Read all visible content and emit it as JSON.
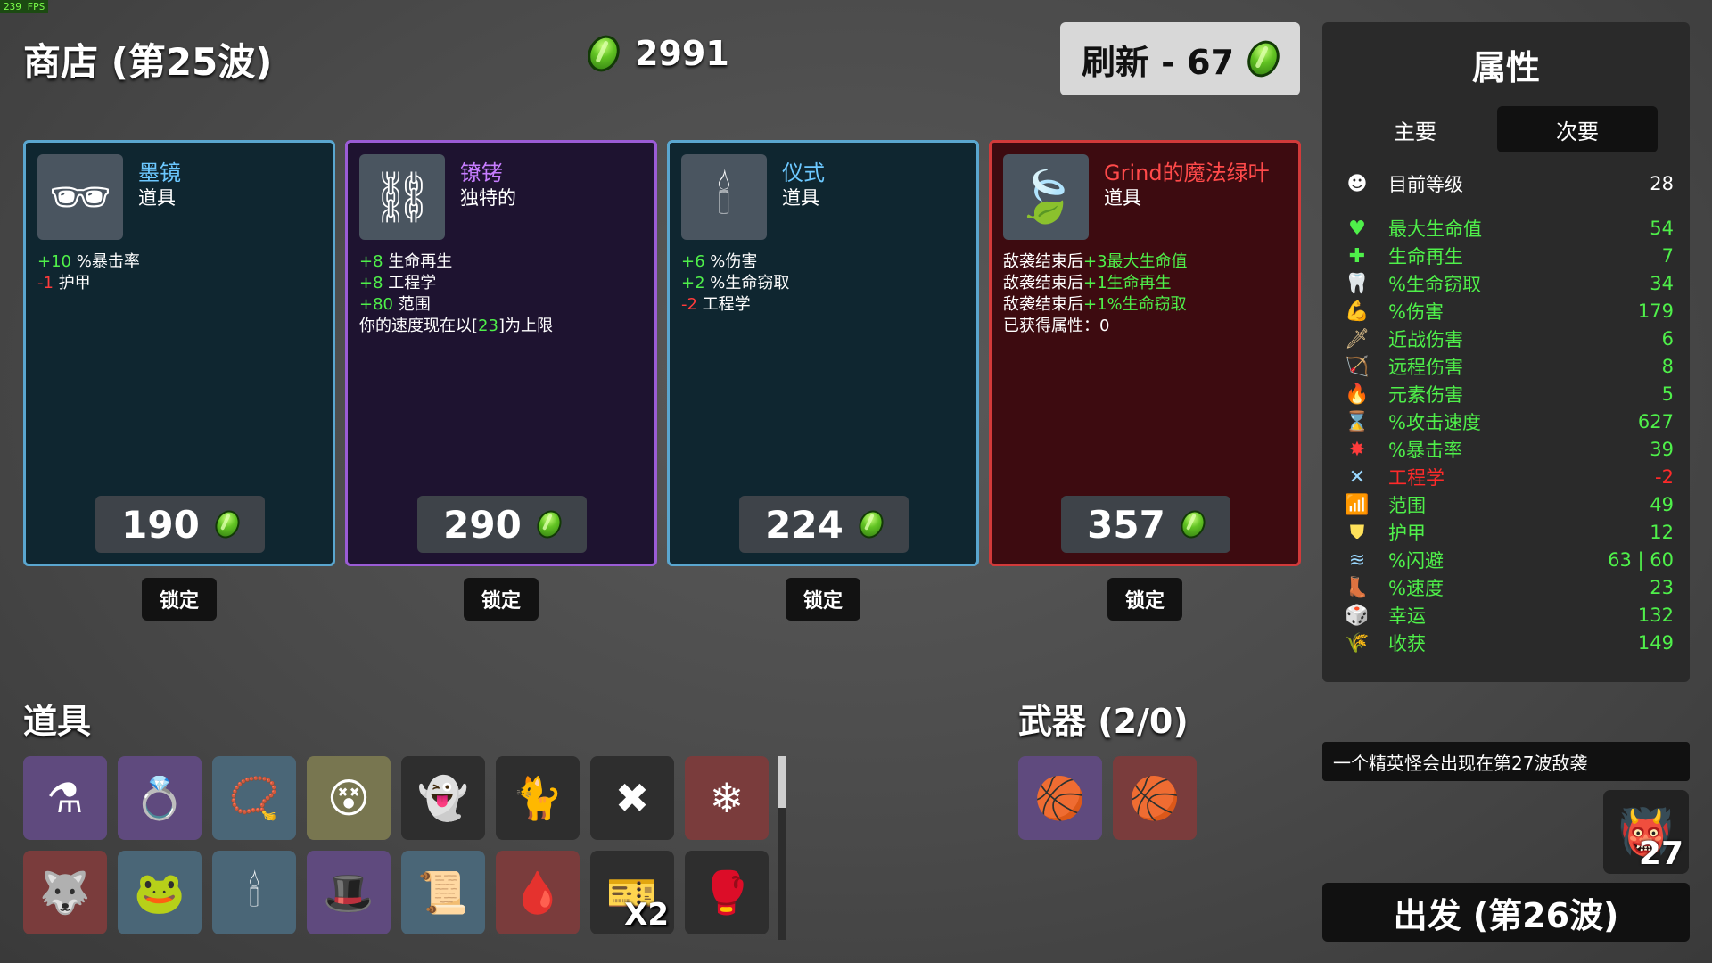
{
  "fps": "239 FPS",
  "header": {
    "title": "商店 (第25波)",
    "gold": "2991",
    "reroll_label": "刷新 - 67"
  },
  "shop": [
    {
      "name": "墨镜",
      "type": "道具",
      "name_color": "#6cc8ff",
      "border": "#5aa6cf",
      "bg": "#0f2630",
      "icon": "sunglasses-icon",
      "stats": [
        [
          "+10",
          " %暴击率"
        ],
        [
          "-1",
          " 护甲"
        ]
      ],
      "price": "190",
      "lock": "锁定"
    },
    {
      "name": "镣铐",
      "type": "独特的",
      "name_color": "#c77dff",
      "border": "#9b5cd6",
      "bg": "#1e1330",
      "icon": "shackles-icon",
      "stats": [
        [
          "+8",
          " 生命再生"
        ],
        [
          "+8",
          " 工程学"
        ],
        [
          "+80",
          " 范围"
        ]
      ],
      "extra": [
        "你的速度现在以[",
        "23",
        "]为上限"
      ],
      "price": "290",
      "lock": "锁定"
    },
    {
      "name": "仪式",
      "type": "道具",
      "name_color": "#6cc8ff",
      "border": "#5aa6cf",
      "bg": "#0f2630",
      "icon": "ritual-icon",
      "stats": [
        [
          "+6",
          " %伤害"
        ],
        [
          "+2",
          " %生命窃取"
        ],
        [
          "-2",
          " 工程学"
        ]
      ],
      "price": "224",
      "lock": "锁定"
    },
    {
      "name": "Grind的魔法绿叶",
      "type": "道具",
      "name_color": "#ff4a4a",
      "border": "#d23a3a",
      "bg": "#3d0b10",
      "icon": "magic-leaf-icon",
      "lines": [
        [
          "敌袭结束后",
          "+3最大生命值"
        ],
        [
          "敌袭结束后",
          "+1生命再生"
        ],
        [
          "敌袭结束后",
          "+1%生命窃取"
        ]
      ],
      "acquired": "已获得属性：0",
      "price": "357",
      "lock": "锁定"
    }
  ],
  "items_title": "道具",
  "items": [
    {
      "icon": "potion-machine-icon",
      "glyph": "⚗",
      "cls": "c-purple"
    },
    {
      "icon": "ring-icon",
      "glyph": "💍",
      "cls": "c-purple"
    },
    {
      "icon": "pendant-icon",
      "glyph": "📿",
      "cls": "c-blue"
    },
    {
      "icon": "face-icon",
      "glyph": "😵",
      "cls": "c-gold"
    },
    {
      "icon": "ghost-icon",
      "glyph": "👻",
      "cls": "c-dark"
    },
    {
      "icon": "cat-icon",
      "glyph": "🐈",
      "cls": "c-dark"
    },
    {
      "icon": "red-cross-icon",
      "glyph": "✖",
      "cls": "c-dark"
    },
    {
      "icon": "snowflake-icon",
      "glyph": "❄",
      "cls": "c-red"
    },
    {
      "icon": "wolf-icon",
      "glyph": "🐺",
      "cls": "c-red"
    },
    {
      "icon": "frog-icon",
      "glyph": "🐸",
      "cls": "c-blue"
    },
    {
      "icon": "ritual-item-icon",
      "glyph": "🕯",
      "cls": "c-blue"
    },
    {
      "icon": "hat-icon",
      "glyph": "🎩",
      "cls": "c-purple"
    },
    {
      "icon": "scroll-icon",
      "glyph": "📜",
      "cls": "c-blue"
    },
    {
      "icon": "claw-icon",
      "glyph": "🩸",
      "cls": "c-red"
    },
    {
      "icon": "ticket-icon",
      "glyph": "🎫",
      "cls": "c-dark",
      "count": "X2"
    },
    {
      "icon": "boxing-glove-icon",
      "glyph": "🥊",
      "cls": "c-dark"
    }
  ],
  "weapons_title": "武器 (2/0)",
  "weapons": [
    {
      "icon": "ball-icon",
      "glyph": "🏀",
      "cls": "c-purple"
    },
    {
      "icon": "ball-icon",
      "glyph": "🏀",
      "cls": "c-red"
    }
  ],
  "stats_panel": {
    "title": "属性",
    "tab_primary": "主要",
    "tab_secondary": "次要",
    "level_label": "目前等级",
    "level_value": "28",
    "rows": [
      {
        "icon": "heart-icon",
        "glyph": "♥",
        "icolor": "#4ff04a",
        "label": "最大生命值",
        "value": "54",
        "color": "#4ff04a"
      },
      {
        "icon": "heart-plus-icon",
        "glyph": "✚",
        "icolor": "#4ff04a",
        "label": "生命再生",
        "value": "7",
        "color": "#4ff04a"
      },
      {
        "icon": "fangs-icon",
        "glyph": "🦷",
        "icolor": "#ff6060",
        "label": "%生命窃取",
        "value": "34",
        "color": "#4ff04a"
      },
      {
        "icon": "muscle-icon",
        "glyph": "💪",
        "icolor": "#ff8080",
        "label": "%伤害",
        "value": "179",
        "color": "#4ff04a"
      },
      {
        "icon": "sword-icon",
        "glyph": "🗡",
        "icolor": "#e8c890",
        "label": "近战伤害",
        "value": "6",
        "color": "#4ff04a"
      },
      {
        "icon": "bow-icon",
        "glyph": "🏹",
        "icolor": "#d080ff",
        "label": "远程伤害",
        "value": "8",
        "color": "#4ff04a"
      },
      {
        "icon": "flame-icon",
        "glyph": "🔥",
        "icolor": "#ff9a4a",
        "label": "元素伤害",
        "value": "5",
        "color": "#4ff04a"
      },
      {
        "icon": "hourglass-icon",
        "glyph": "⌛",
        "icolor": "#ffffff",
        "label": "%攻击速度",
        "value": "627",
        "color": "#4ff04a"
      },
      {
        "icon": "crit-icon",
        "glyph": "✸",
        "icolor": "#ff3b3b",
        "label": "%暴击率",
        "value": "39",
        "color": "#4ff04a"
      },
      {
        "icon": "wrench-icon",
        "glyph": "✕",
        "icolor": "#9ad8ff",
        "label": "工程学",
        "value": "-2",
        "color": "#ff2a2a"
      },
      {
        "icon": "range-icon",
        "glyph": "📶",
        "icolor": "#d080ff",
        "label": "范围",
        "value": "49",
        "color": "#4ff04a"
      },
      {
        "icon": "shield-icon",
        "glyph": "⛊",
        "icolor": "#ffe15a",
        "label": "护甲",
        "value": "12",
        "color": "#4ff04a"
      },
      {
        "icon": "dodge-icon",
        "glyph": "≋",
        "icolor": "#9ad8ff",
        "label": "%闪避",
        "value": "63 | 60",
        "color": "#4ff04a"
      },
      {
        "icon": "boot-icon",
        "glyph": "👢",
        "icolor": "#ffffff",
        "label": "%速度",
        "value": "23",
        "color": "#4ff04a"
      },
      {
        "icon": "dice-icon",
        "glyph": "🎲",
        "icolor": "#ffffff",
        "label": "幸运",
        "value": "132",
        "color": "#4ff04a"
      },
      {
        "icon": "wheat-icon",
        "glyph": "🌾",
        "icolor": "#ffd870",
        "label": "收获",
        "value": "149",
        "color": "#4ff04a"
      }
    ]
  },
  "notice": "一个精英怪会出现在第27波敌袭",
  "elite_wave": "27",
  "go_label": "出发 (第26波)"
}
